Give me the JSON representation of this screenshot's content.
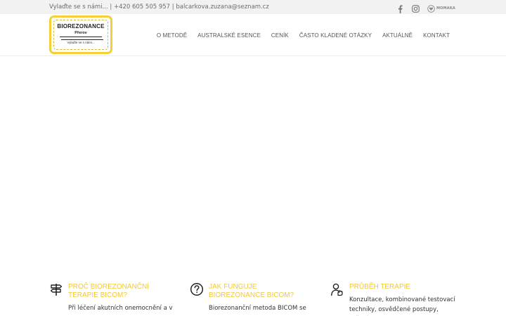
{
  "topbar": {
    "contact": "Vylaďte se s námi... | +420 605 505 957 | balcarkova.zuzana@seznam.cz",
    "social": [
      {
        "icon": "facebook-icon"
      },
      {
        "icon": "instagram-icon"
      },
      {
        "icon": "momaka-icon",
        "label": "MOMAKA"
      }
    ]
  },
  "logo": {
    "title": "BIOREZONANCE",
    "city": "Přerov",
    "slogan": "Vylaďte se s námi..."
  },
  "nav": {
    "items": [
      {
        "label": "O METODĚ"
      },
      {
        "label": "AUSTRALSKÉ ESENCE"
      },
      {
        "label": "CENÍK"
      },
      {
        "label": "ČASTO KLADENÉ OTÁZKY"
      },
      {
        "label": "AKTUÁLNĚ"
      },
      {
        "label": "KONTAKT"
      }
    ]
  },
  "features": [
    {
      "icon": "signpost-icon",
      "title": "PROČ BIOREZONANČNÍ TERAPIE BICOM?",
      "text": "Při léčení akutních onemocnění a v"
    },
    {
      "icon": "question-icon",
      "title": "JAK FUNGUJE BIOREZONANCE BICOM?",
      "text": "Biorezonanční metoda BICOM se"
    },
    {
      "icon": "user-handshake-icon",
      "title": "PRŮBĚH TERAPIE",
      "text": "Konzultace, kombinované testovací techniky, osvědčené postupy, určení"
    }
  ],
  "colors": {
    "accent": "#f2c935",
    "topbar_bg": "#f2f2f2"
  }
}
